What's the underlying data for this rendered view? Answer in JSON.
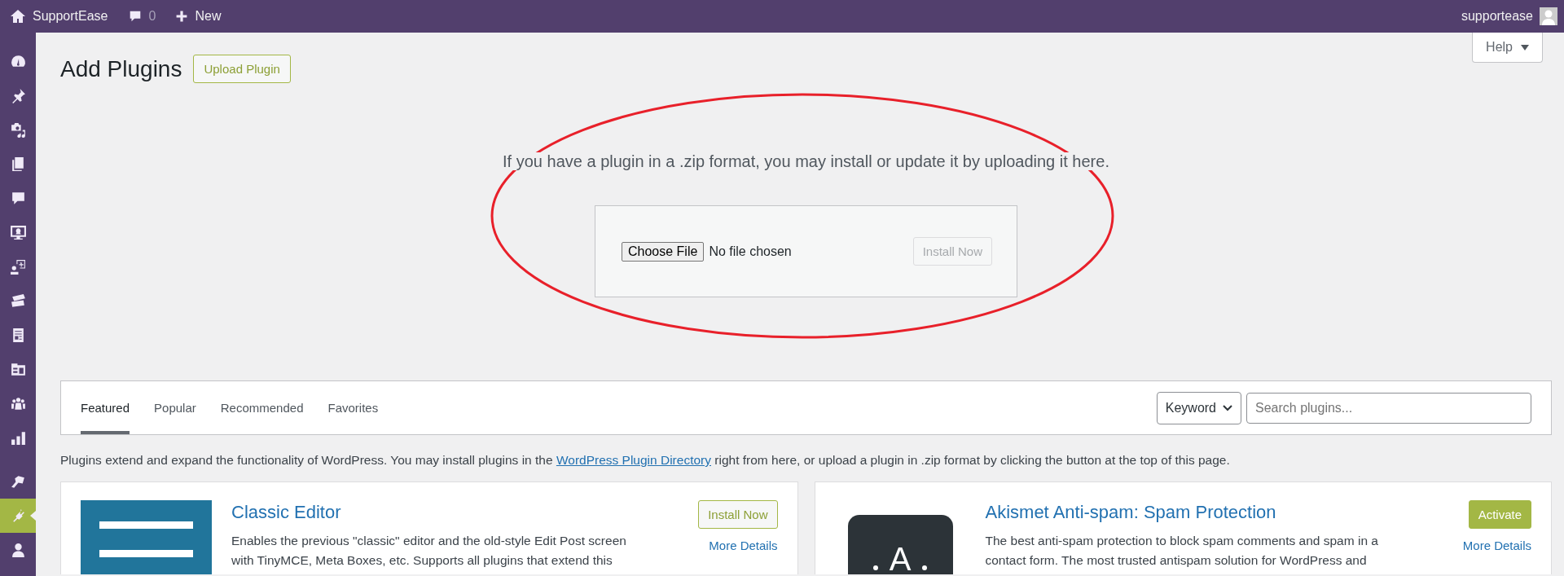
{
  "admin_bar": {
    "site": "SupportEase",
    "comments": "0",
    "new": "New",
    "user": "supportease"
  },
  "sidebar": {
    "items": [
      {
        "selected": false
      },
      {
        "selected": false
      },
      {
        "selected": false
      },
      {
        "selected": false
      },
      {
        "selected": false
      },
      {
        "selected": false
      },
      {
        "selected": false
      },
      {
        "selected": false
      },
      {
        "selected": false
      },
      {
        "selected": false
      },
      {
        "selected": false
      },
      {
        "selected": false
      },
      {
        "selected": false
      },
      {
        "selected": true
      },
      {
        "selected": false
      }
    ]
  },
  "help": "Help",
  "page": {
    "title": "Add Plugins",
    "upload_button": "Upload Plugin"
  },
  "upload": {
    "message": "If you have a plugin in a .zip format, you may install or update it by uploading it here.",
    "choose_file": "Choose File",
    "file_status": "No file chosen",
    "install_button": "Install Now",
    "install_disabled": true
  },
  "annotation": {
    "kind": "ellipse",
    "color": "#e8202a"
  },
  "filter": {
    "tabs": [
      {
        "label": "Featured",
        "selected": true
      },
      {
        "label": "Popular",
        "selected": false
      },
      {
        "label": "Recommended",
        "selected": false
      },
      {
        "label": "Favorites",
        "selected": false
      }
    ],
    "search_type": "Keyword",
    "search": {
      "placeholder": "Search plugins..."
    }
  },
  "intro": {
    "before": "Plugins extend and expand the functionality of WordPress. You may install plugins in the ",
    "link": "WordPress Plugin Directory",
    "after": " right from here, or upload a plugin in .zip format by clicking the button at the top of this page."
  },
  "plugins": [
    {
      "name": "Classic Editor",
      "logo": {
        "kind": "lines"
      },
      "description": "Enables the previous \"classic\" editor and the old-style Edit Post screen with TinyMCE, Meta Boxes, etc. Supports all plugins that extend this",
      "action": {
        "label": "Install Now",
        "kind": "install"
      },
      "details": "More Details"
    },
    {
      "name": "Akismet Anti-spam: Spam Protection",
      "logo": {
        "kind": "letter",
        "text": "A"
      },
      "description": "The best anti-spam protection to block spam comments and spam in a contact form. The most trusted antispam solution for WordPress and",
      "action": {
        "label": "Activate",
        "kind": "activate"
      },
      "details": "More Details"
    }
  ]
}
